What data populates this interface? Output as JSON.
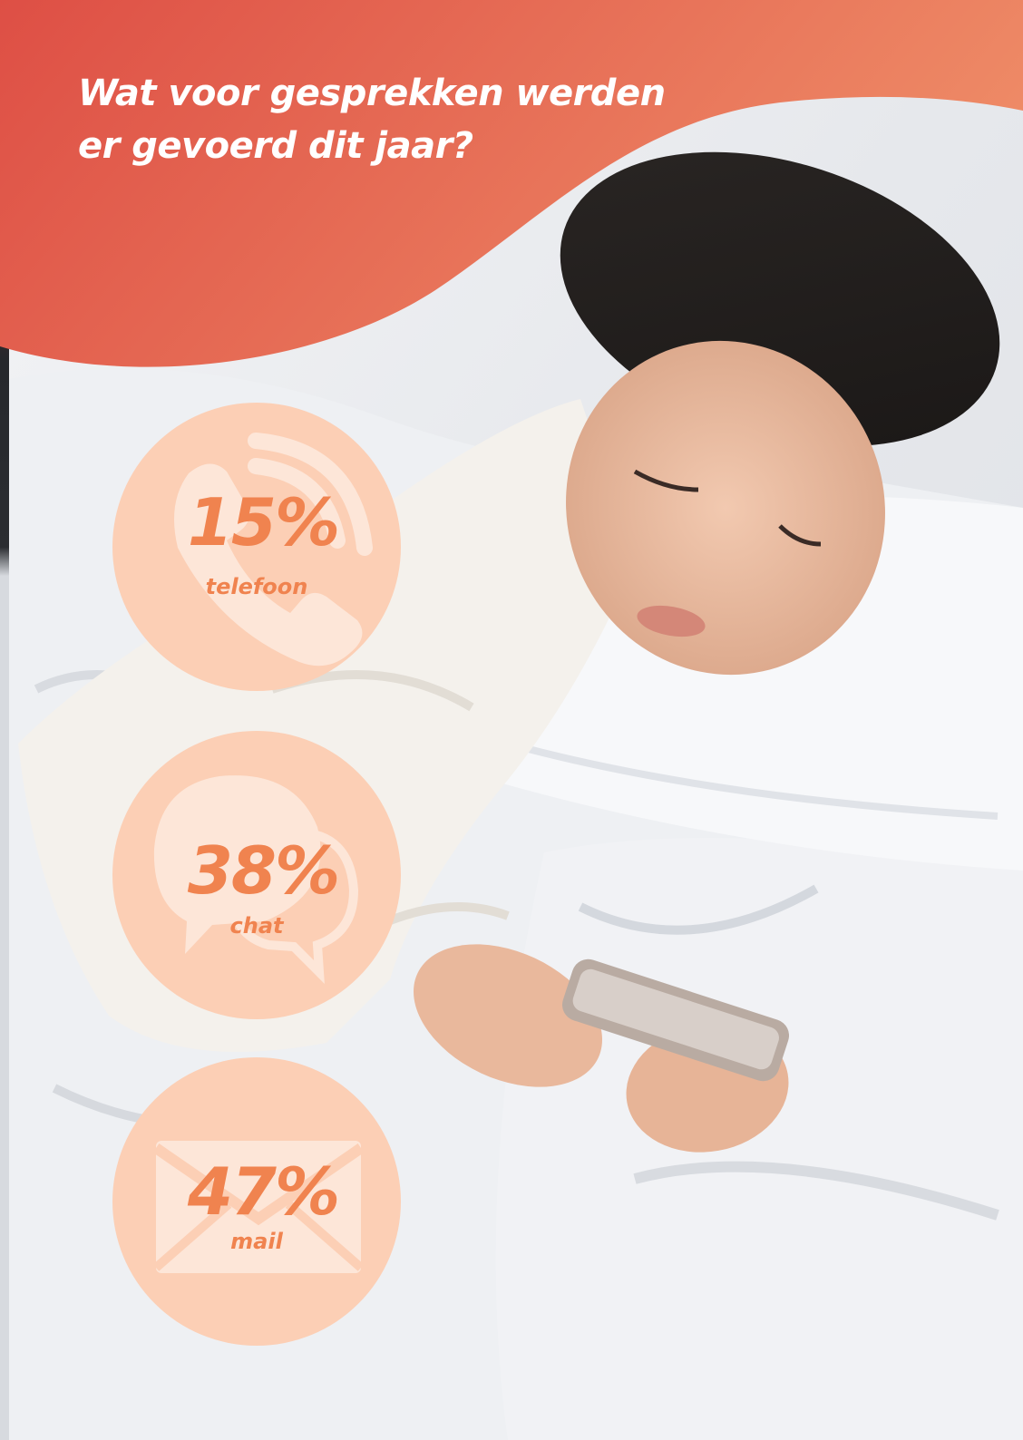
{
  "header": {
    "title_line1": "Wat voor gesprekken werden",
    "title_line2": "er gevoerd dit jaar?",
    "color_start": "#de4f45",
    "color_end": "#ee8a66"
  },
  "stats": [
    {
      "value": "15%",
      "label": "telefoon",
      "icon": "phone-icon"
    },
    {
      "value": "38%",
      "label": "chat",
      "icon": "chat-bubbles-icon"
    },
    {
      "value": "47%",
      "label": "mail",
      "icon": "envelope-icon"
    }
  ],
  "colors": {
    "circle_fill": "#fccfb5",
    "icon_fill": "#fde6d8",
    "accent_text": "#f0834f"
  },
  "photo": {
    "subject": "woman-in-bed-with-smartphone"
  }
}
